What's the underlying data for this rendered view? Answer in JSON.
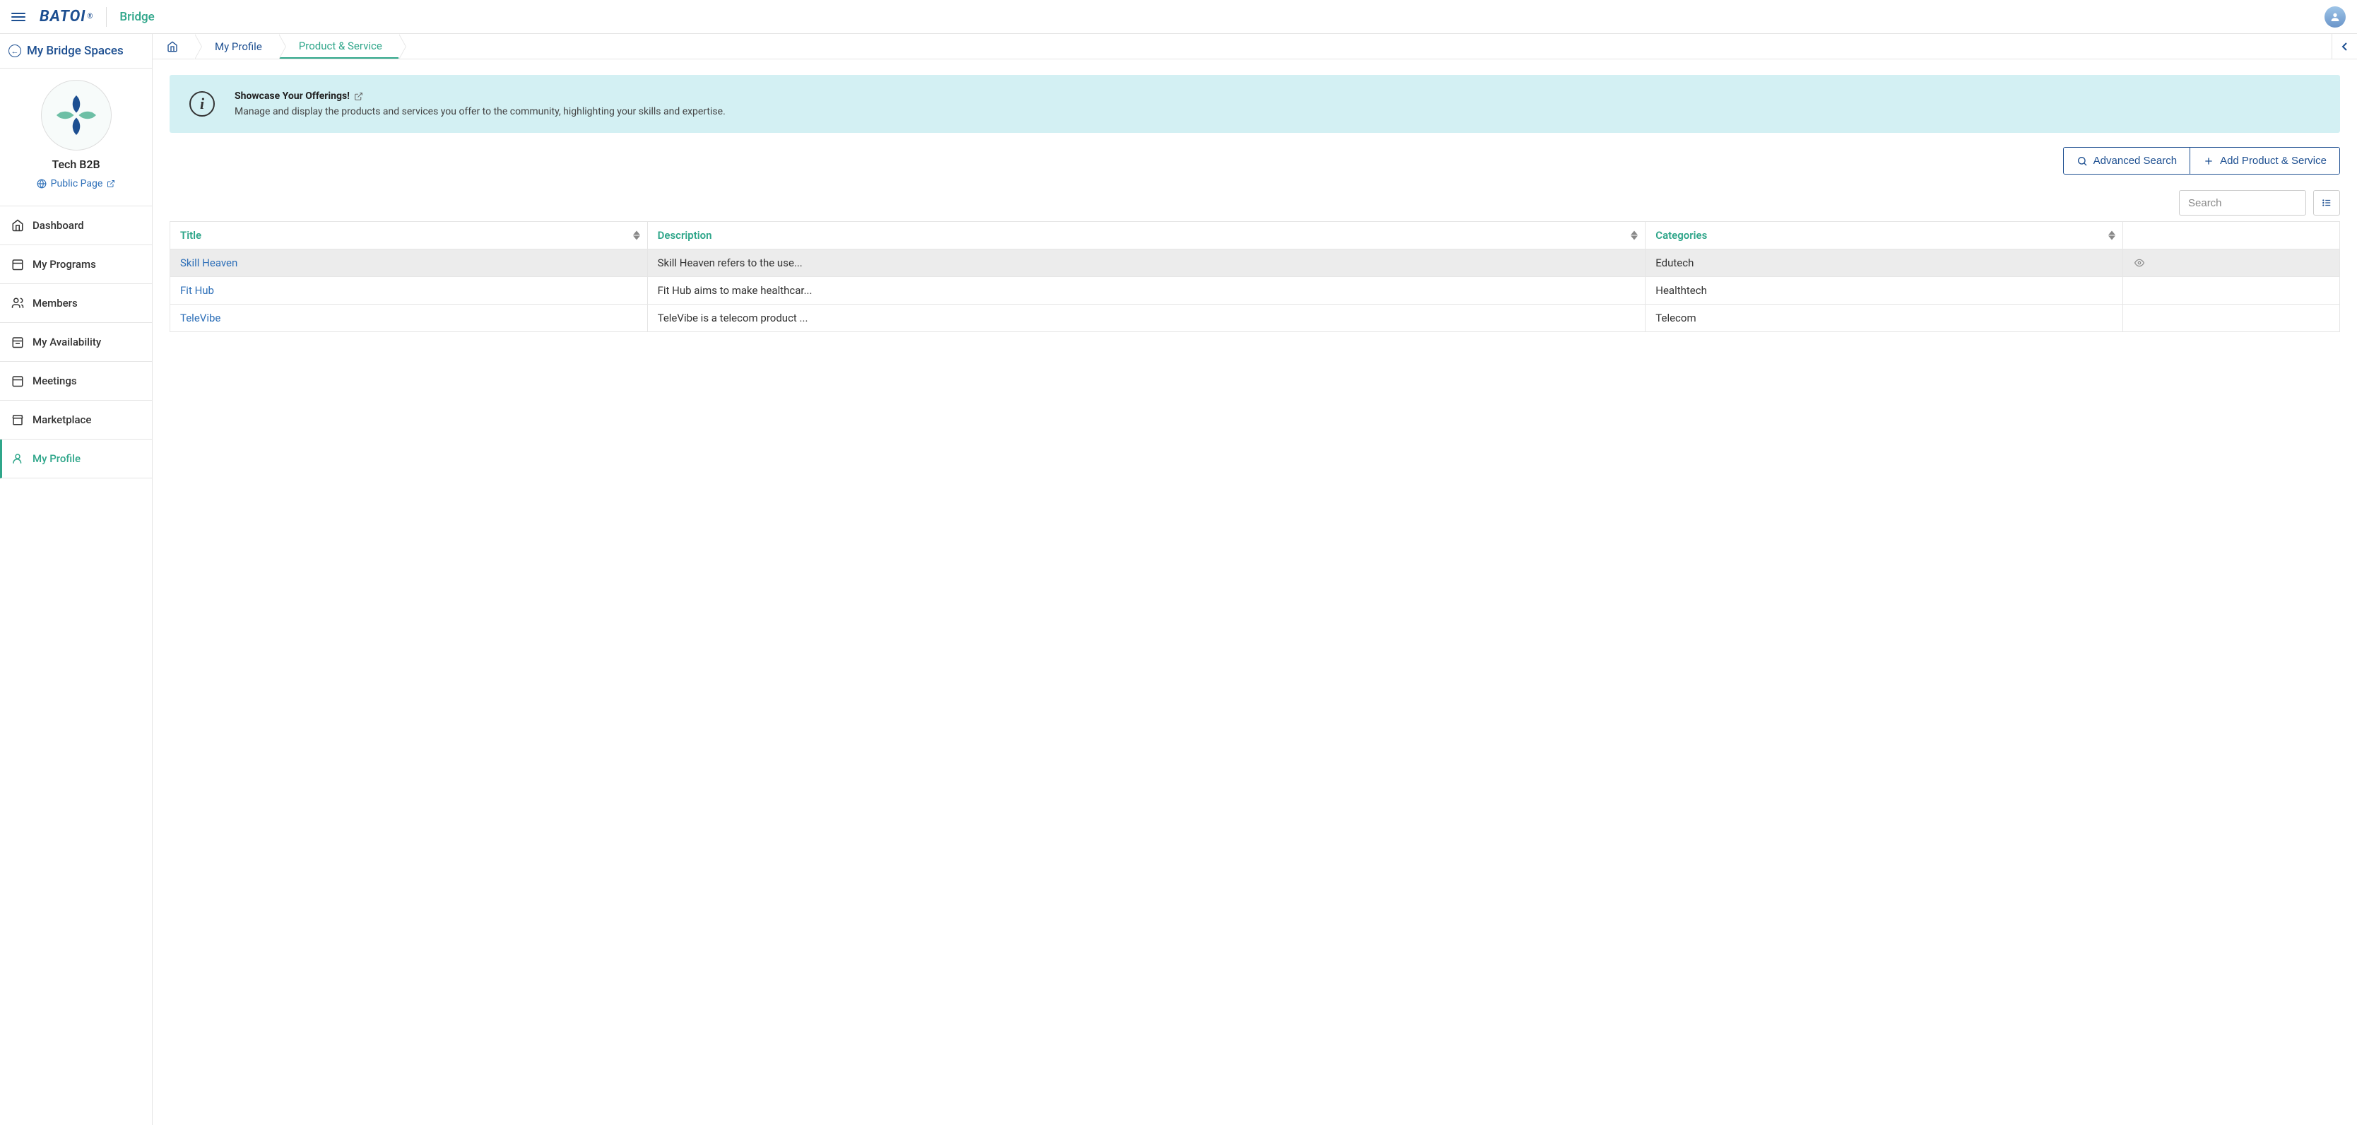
{
  "topbar": {
    "logo_text": "BATOI",
    "logo_reg": "®",
    "app_name": "Bridge"
  },
  "sidebar": {
    "back_label": "My Bridge Spaces",
    "space_name": "Tech B2B",
    "public_page_label": "Public Page",
    "nav": [
      {
        "key": "dashboard",
        "label": "Dashboard",
        "active": false
      },
      {
        "key": "my-programs",
        "label": "My Programs",
        "active": false
      },
      {
        "key": "members",
        "label": "Members",
        "active": false
      },
      {
        "key": "my-availability",
        "label": "My Availability",
        "active": false
      },
      {
        "key": "meetings",
        "label": "Meetings",
        "active": false
      },
      {
        "key": "marketplace",
        "label": "Marketplace",
        "active": false
      },
      {
        "key": "my-profile",
        "label": "My Profile",
        "active": true
      }
    ]
  },
  "breadcrumb": {
    "items": [
      {
        "key": "home",
        "label": "",
        "icon_only": true
      },
      {
        "key": "my-profile",
        "label": "My Profile"
      },
      {
        "key": "product-service",
        "label": "Product & Service",
        "active": true
      }
    ]
  },
  "banner": {
    "title": "Showcase Your Offerings!",
    "description": "Manage and display the products and services you offer to the community, highlighting your skills and expertise."
  },
  "actions": {
    "advanced_search": "Advanced Search",
    "add_product_service": "Add Product & Service"
  },
  "search": {
    "placeholder": "Search",
    "value": ""
  },
  "table": {
    "headers": {
      "title": "Title",
      "description": "Description",
      "categories": "Categories",
      "actions": ""
    },
    "rows": [
      {
        "title": "Skill Heaven",
        "description": "Skill Heaven refers to the use...",
        "categories": "Edutech",
        "eye": true
      },
      {
        "title": "Fit Hub",
        "description": "Fit Hub aims to make healthcar...",
        "categories": "Healthtech",
        "eye": false
      },
      {
        "title": "TeleVibe",
        "description": "TeleVibe is a telecom product ...",
        "categories": "Telecom",
        "eye": false
      }
    ]
  }
}
